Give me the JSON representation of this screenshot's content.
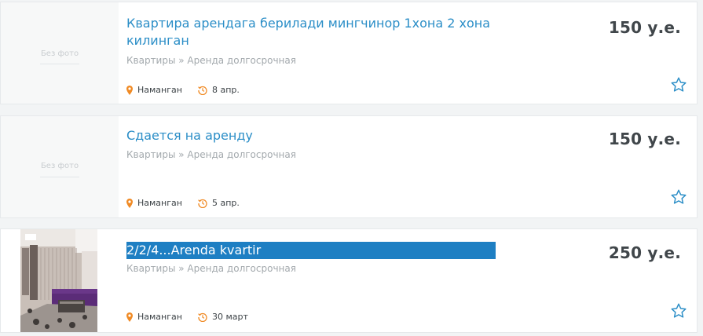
{
  "listings": [
    {
      "title": "Квартира арендага берилади мингчинор 1хона 2 хона килинган",
      "category": "Квартиры » Аренда долгосрочная",
      "location": "Наманган",
      "date": "8 апр.",
      "price": "150 у.е.",
      "no_photo_label": "Без фото",
      "has_photo": false,
      "title_selected": false
    },
    {
      "title": "Сдается на аренду",
      "category": "Квартиры » Аренда долгосрочная",
      "location": "Наманган",
      "date": "5 апр.",
      "price": "150 у.е.",
      "no_photo_label": "Без фото",
      "has_photo": false,
      "title_selected": false
    },
    {
      "title": "2/2/4...Arenda kvartir",
      "category": "Квартиры » Аренда долгосрочная",
      "location": "Наманган",
      "date": "30 март",
      "price": "250 у.е.",
      "has_photo": true,
      "title_selected": true
    }
  ],
  "colors": {
    "link": "#2b8ec7",
    "marker": "#f08a24",
    "star": "#2b8ec7",
    "selection": "#1e7fc3"
  },
  "icons": {
    "location": "map-pin-icon",
    "date": "clock-history-icon",
    "favorite": "star-outline-icon"
  }
}
